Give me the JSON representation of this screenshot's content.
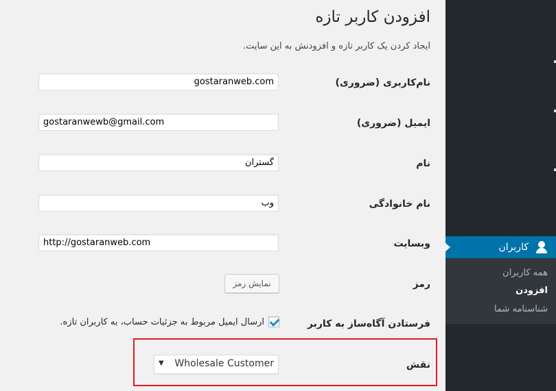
{
  "page": {
    "title": "افزودن کاربر تازه",
    "description": "ایجاد کردن یک کاربر تازه و افزودنش به این سایت."
  },
  "form": {
    "username": {
      "label": "نام‌کاربری (ضروری)",
      "value": "gostaranweb.com"
    },
    "email": {
      "label": "ایمیل (ضروری)",
      "value": "gostaranwewb@gmail.com"
    },
    "first_name": {
      "label": "نام",
      "value": "گستران"
    },
    "last_name": {
      "label": "نام خانوادگی",
      "value": "وب"
    },
    "website": {
      "label": "وبسایت",
      "value": "http://gostaranweb.com"
    },
    "password": {
      "label": "رمز",
      "button_label": "نمایش رمز"
    },
    "notify": {
      "label": "فرستادن آگاه‌ساز به کاربر",
      "checkbox_label": "ارسال ایمیل مربوط به جزئیات حساب، به کاربران تازه.",
      "checked": true
    },
    "role": {
      "label": "نقش",
      "selected": "Wholesale Customer"
    }
  },
  "sidebar": {
    "menu_users": {
      "label": "کاربران",
      "icon": "user-icon"
    },
    "submenu": [
      {
        "label": "همه کاربران",
        "active": false
      },
      {
        "label": "افزودن",
        "active": true
      },
      {
        "label": "شناسنامه شما",
        "active": false
      }
    ]
  },
  "colors": {
    "accent": "#0073aa",
    "sidebar_bg": "#23282d",
    "submenu_bg": "#32373c",
    "highlight": "#e31b23"
  }
}
